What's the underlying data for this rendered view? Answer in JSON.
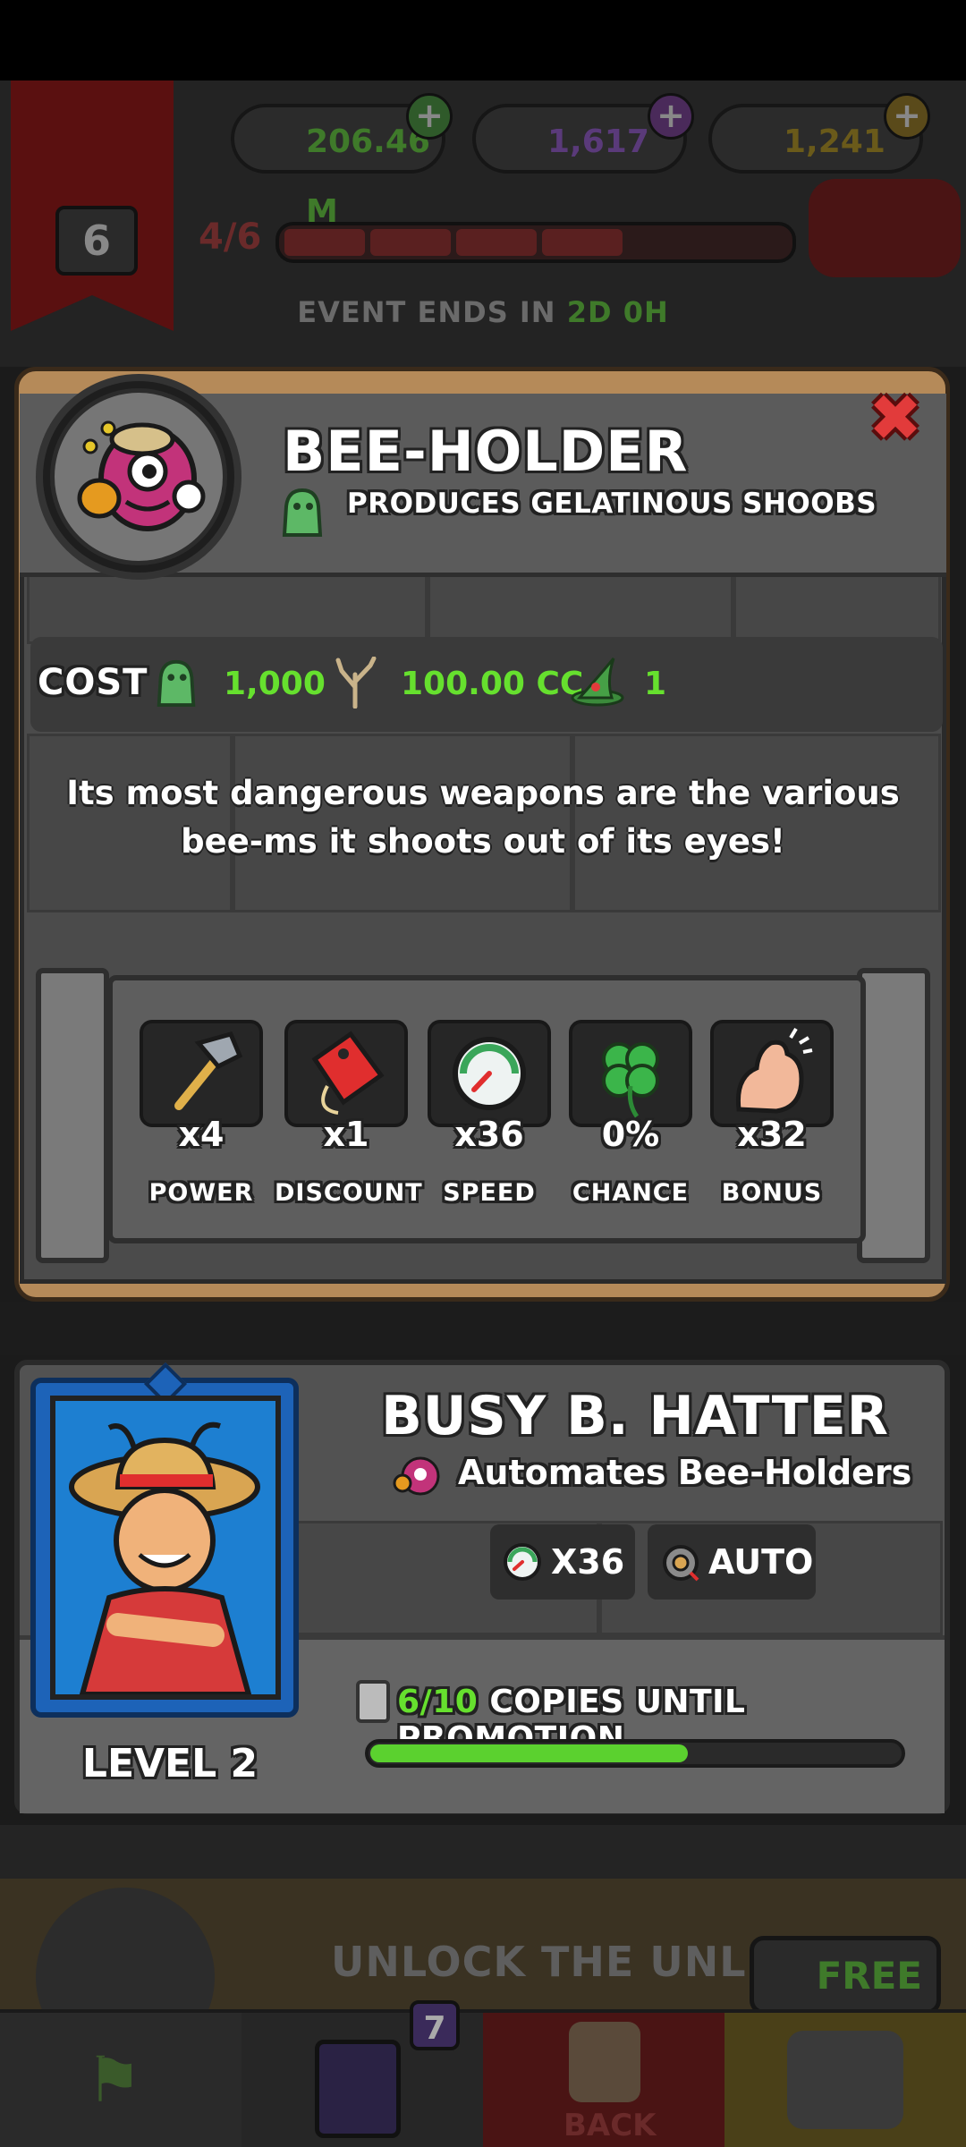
{
  "hud": {
    "level_number": "6",
    "currency_green": "206.46 M",
    "currency_purple": "1,617",
    "currency_gold": "1,241",
    "progress_text": "4/6",
    "event_label": "EVENT ENDS IN",
    "event_time": "2D 0H"
  },
  "popup": {
    "title": "BEE-HOLDER",
    "subtitle": "PRODUCES GELATINOUS SHOOBS",
    "cost_label": "COST",
    "cost_1": "1,000",
    "cost_2": "100.00 CC",
    "cost_3": "1",
    "description": "Its most dangerous weapons are the various bee-ms it shoots out of its eyes!",
    "stats": [
      {
        "value": "x4",
        "label": "POWER"
      },
      {
        "value": "x1",
        "label": "DISCOUNT"
      },
      {
        "value": "x36",
        "label": "SPEED"
      },
      {
        "value": "0%",
        "label": "CHANCE"
      },
      {
        "value": "x32",
        "label": "BONUS"
      }
    ]
  },
  "hero": {
    "name": "BUSY B. HATTER",
    "description": "Automates Bee-Holders",
    "speed_chip": "X36",
    "auto_chip": "AUTO",
    "level": "LEVEL 2",
    "copies_count": "6/10",
    "copies_text": "COPIES UNTIL PROMOTION",
    "copies_progress": 0.6
  },
  "bottom": {
    "unlock_text": "UNLOCK THE UNLED",
    "free_label": "FREE",
    "cards_badge": "7",
    "back_label": "BACK"
  },
  "colors": {
    "accent_green": "#66e02e",
    "close_red": "#e23b3b",
    "hero_frame_blue": "#1d63b8"
  }
}
